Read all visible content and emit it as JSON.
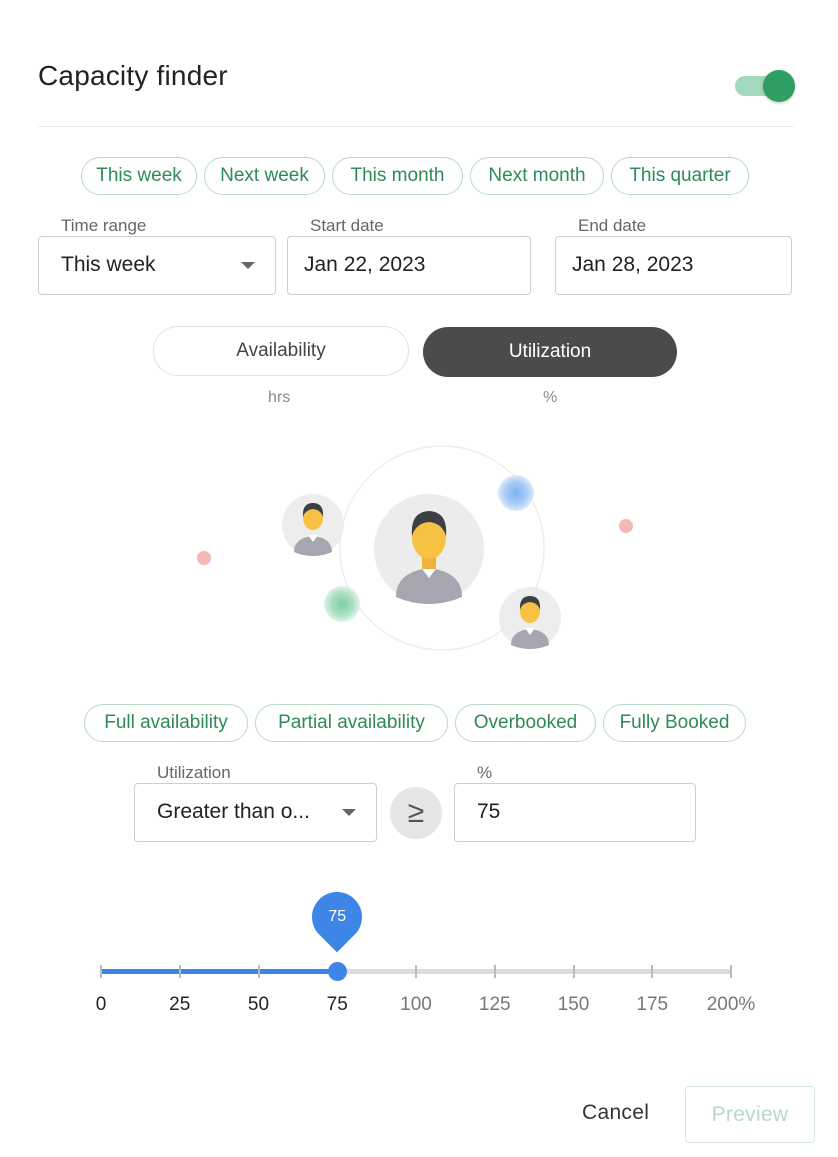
{
  "header": {
    "title": "Capacity finder",
    "toggle_on": true
  },
  "period_chips": [
    "This week",
    "Next week",
    "This month",
    "Next month",
    "This quarter"
  ],
  "time_range": {
    "label": "Time range",
    "value": "This week"
  },
  "start_date": {
    "label": "Start date",
    "value": "Jan 22, 2023"
  },
  "end_date": {
    "label": "End date",
    "value": "Jan 28, 2023"
  },
  "mode": {
    "options": [
      {
        "label": "Availability",
        "unit": "hrs",
        "selected": false
      },
      {
        "label": "Utilization",
        "unit": "%",
        "selected": true
      }
    ]
  },
  "status_chips": [
    "Full availability",
    "Partial availability",
    "Overbooked",
    "Fully Booked"
  ],
  "utilization_filter": {
    "operator_label": "Utilization",
    "operator_value": "Greater than o...",
    "symbol": "≥",
    "value_label": "%",
    "value": "75"
  },
  "slider": {
    "value": 75,
    "value_label": "75",
    "max": 200,
    "ticks": [
      "0",
      "25",
      "50",
      "75",
      "100",
      "125",
      "150",
      "175",
      "200%"
    ]
  },
  "footer": {
    "cancel_label": "Cancel",
    "preview_label": "Preview"
  },
  "colors": {
    "accent_green": "#2e9e63",
    "slider_blue": "#3d86e8",
    "selected_dark": "#4a4c4b"
  }
}
